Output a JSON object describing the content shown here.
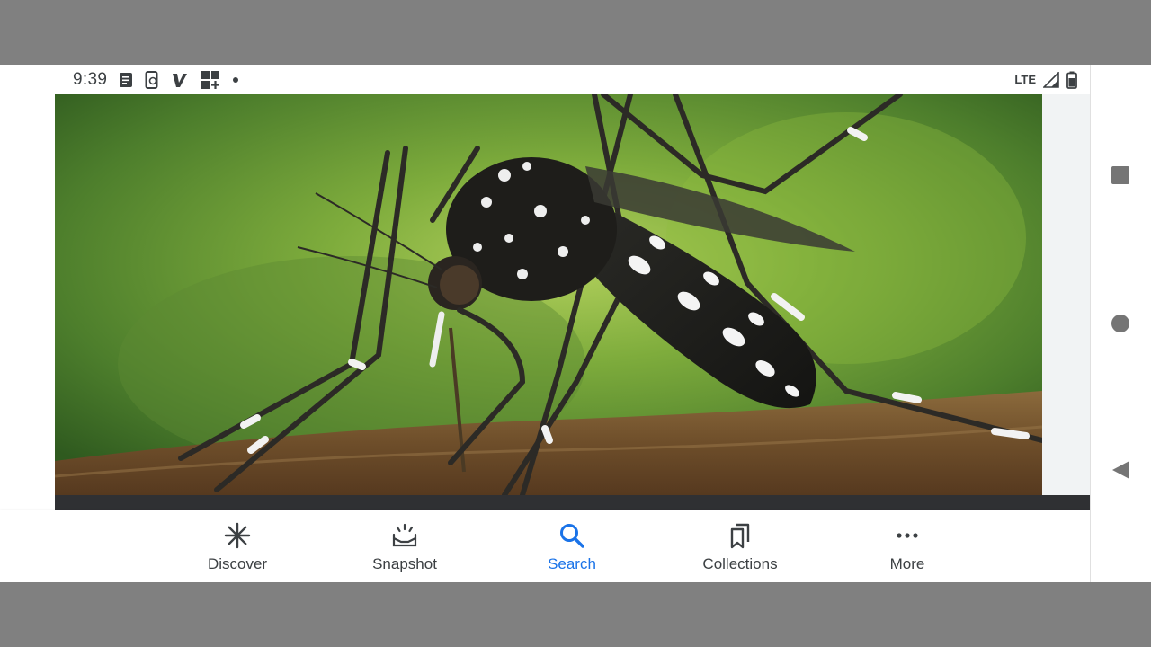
{
  "status_bar": {
    "time": "9:39",
    "network": "LTE",
    "icons": [
      "notes-icon",
      "device-icon",
      "venmo-icon",
      "apps-icon",
      "dot-icon",
      "signal-icon",
      "battery-icon"
    ]
  },
  "content": {
    "image_subject": "mosquito-photo"
  },
  "bottom_nav": {
    "items": [
      {
        "label": "Discover",
        "icon": "discover-icon"
      },
      {
        "label": "Snapshot",
        "icon": "snapshot-icon"
      },
      {
        "label": "Search",
        "icon": "search-icon",
        "active": true
      },
      {
        "label": "Collections",
        "icon": "collections-icon"
      },
      {
        "label": "More",
        "icon": "more-icon"
      }
    ]
  },
  "colors": {
    "accent": "#1a73e8",
    "text": "#3c4043",
    "background": "#808080"
  },
  "system_nav": [
    "recents-button",
    "home-button",
    "back-button"
  ]
}
